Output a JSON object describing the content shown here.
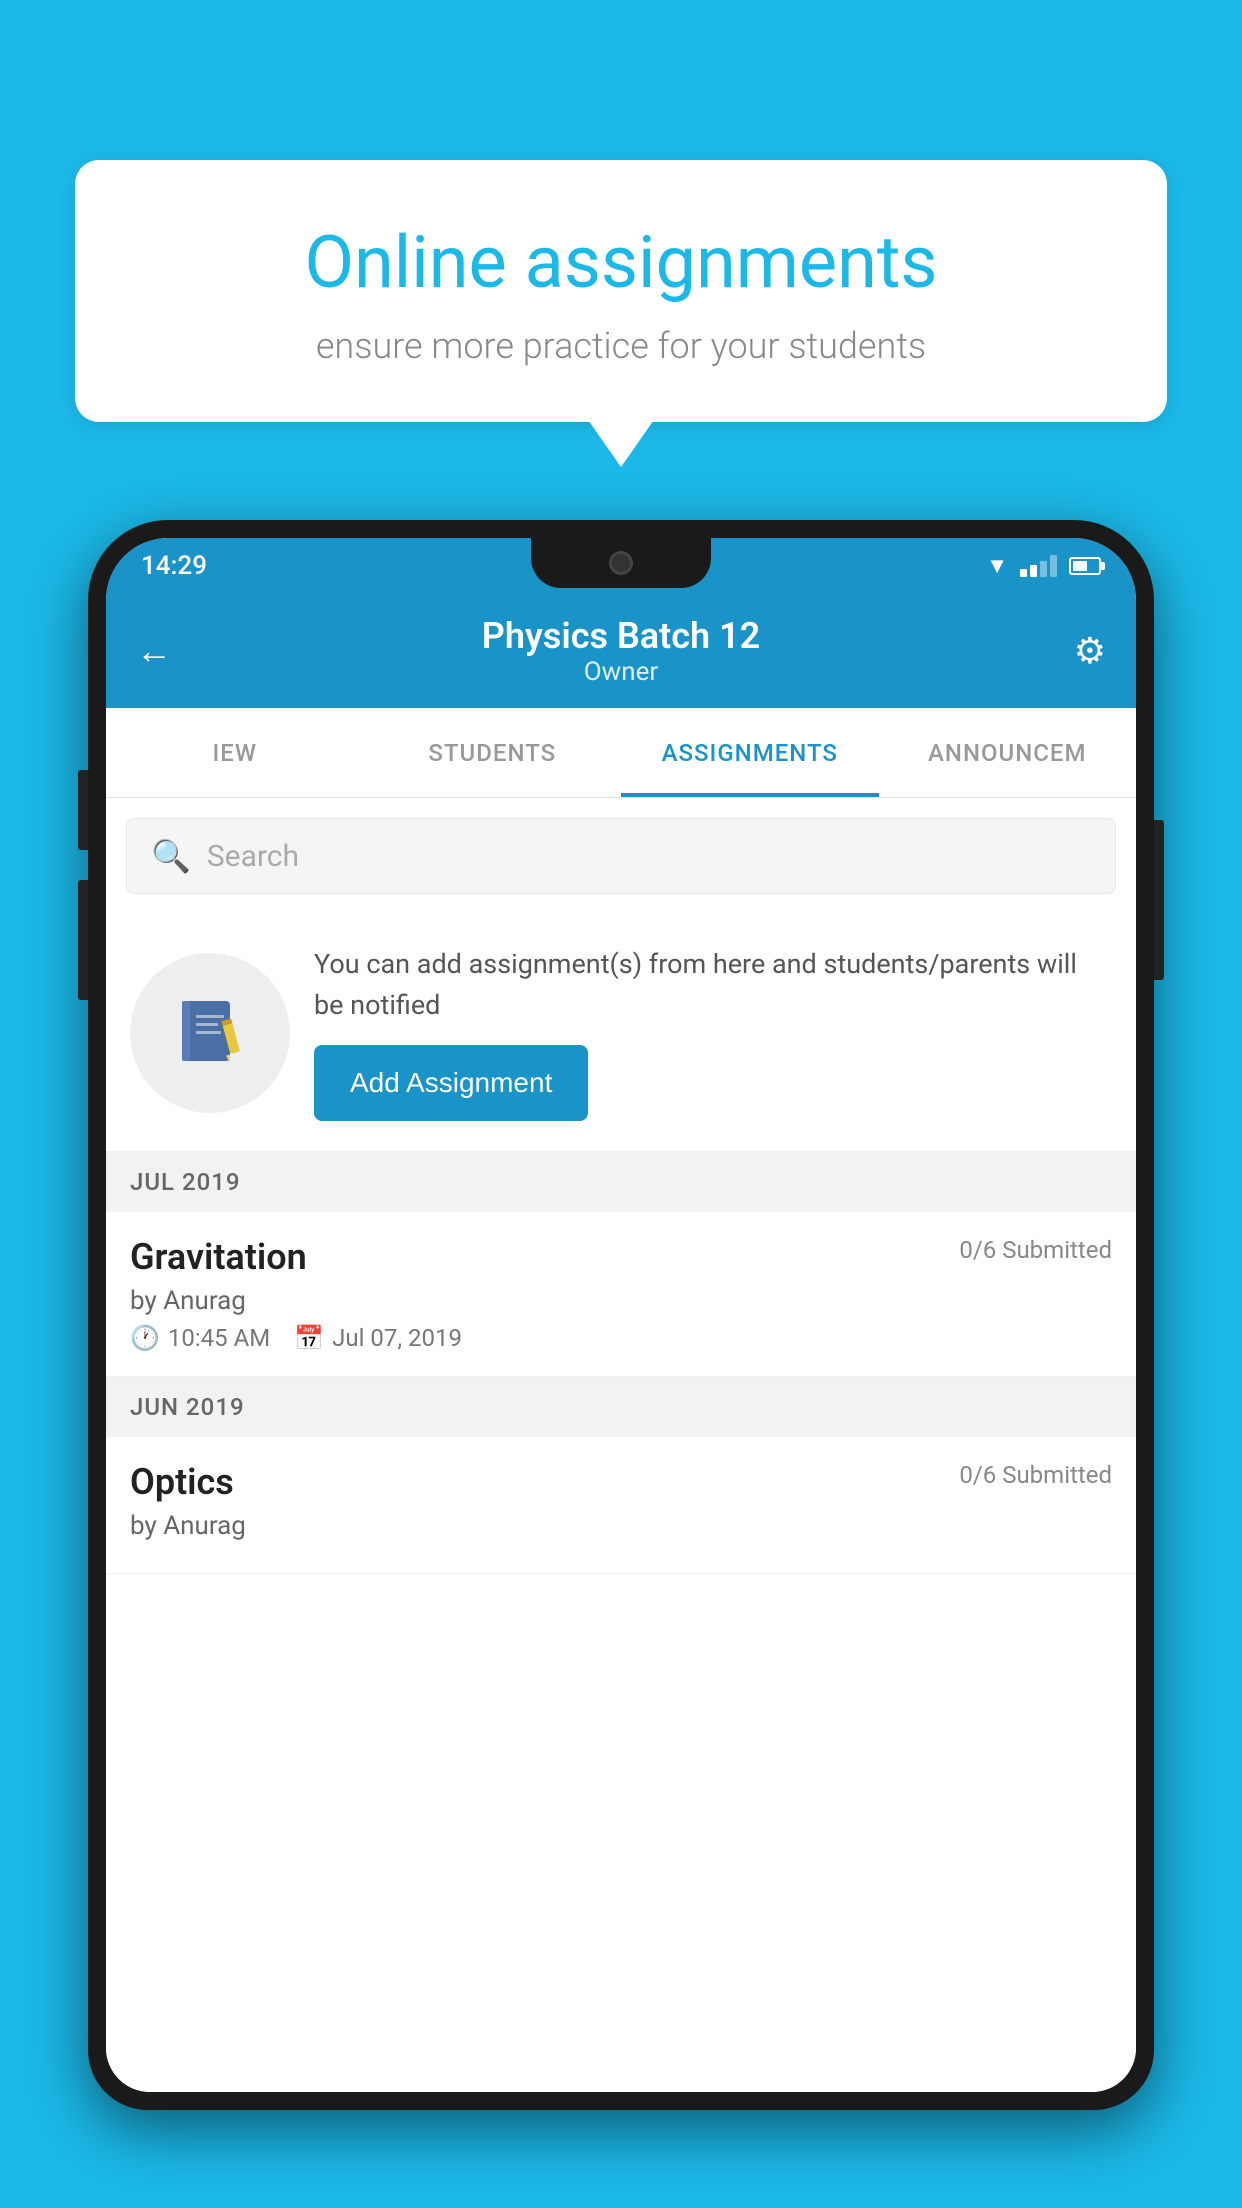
{
  "background_color": "#1bb8e8",
  "speech_bubble": {
    "title": "Online assignments",
    "subtitle": "ensure more practice for your students"
  },
  "phone": {
    "status_bar": {
      "time": "14:29"
    },
    "header": {
      "title": "Physics Batch 12",
      "subtitle": "Owner",
      "back_label": "←",
      "gear_label": "⚙"
    },
    "tabs": [
      {
        "id": "view",
        "label": "IEW",
        "active": false
      },
      {
        "id": "students",
        "label": "STUDENTS",
        "active": false
      },
      {
        "id": "assignments",
        "label": "ASSIGNMENTS",
        "active": true
      },
      {
        "id": "announcements",
        "label": "ANNOUNCEM",
        "active": false
      }
    ],
    "search": {
      "placeholder": "Search"
    },
    "promo": {
      "text": "You can add assignment(s) from here and students/parents will be notified",
      "button_label": "Add Assignment"
    },
    "sections": [
      {
        "id": "jul-2019",
        "label": "JUL 2019",
        "assignments": [
          {
            "id": "gravitation",
            "name": "Gravitation",
            "submitted": "0/6 Submitted",
            "author": "by Anurag",
            "time": "10:45 AM",
            "date": "Jul 07, 2019"
          }
        ]
      },
      {
        "id": "jun-2019",
        "label": "JUN 2019",
        "assignments": [
          {
            "id": "optics",
            "name": "Optics",
            "submitted": "0/6 Submitted",
            "author": "by Anurag",
            "time": "",
            "date": ""
          }
        ]
      }
    ]
  }
}
